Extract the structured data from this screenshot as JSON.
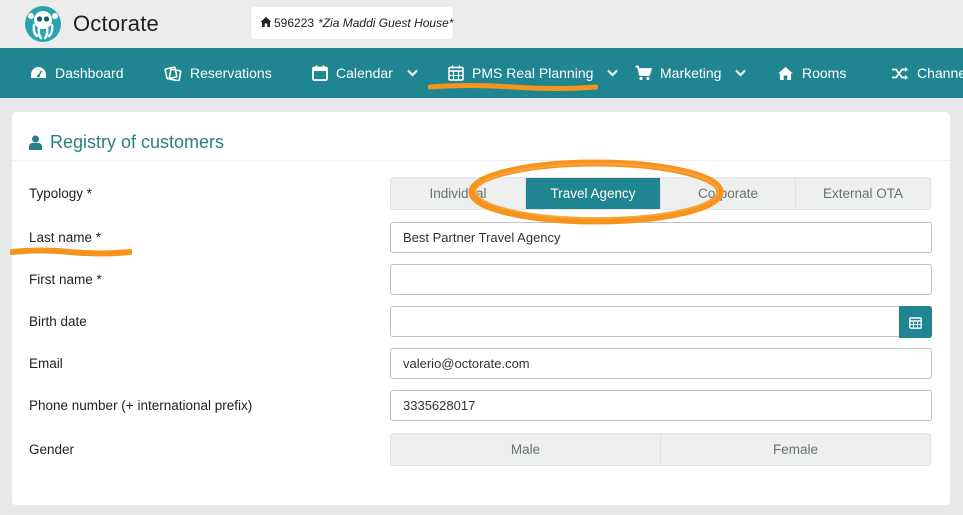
{
  "app": {
    "brand": "Octorate"
  },
  "property": {
    "id": "596223",
    "name": "*Zia Maddi Guest House*"
  },
  "nav": {
    "items": [
      {
        "label": "Dashboard",
        "icon": "dashboard-icon"
      },
      {
        "label": "Reservations",
        "icon": "reservations-icon"
      },
      {
        "label": "Calendar",
        "icon": "calendar-icon",
        "dropdown": true
      },
      {
        "label": "PMS Real Planning",
        "icon": "calendar-grid-icon",
        "dropdown": true,
        "highlighted": true
      },
      {
        "label": "Marketing",
        "icon": "cart-icon",
        "dropdown": true
      },
      {
        "label": "Rooms",
        "icon": "home-icon"
      },
      {
        "label": "Channel",
        "icon": "shuffle-icon"
      }
    ]
  },
  "form": {
    "title": "Registry of customers",
    "typology": {
      "label": "Typology *",
      "options": [
        "Individual",
        "Travel Agency",
        "Corporate",
        "External OTA"
      ],
      "selected": "Travel Agency"
    },
    "last_name": {
      "label": "Last name *",
      "value": "Best Partner Travel Agency"
    },
    "first_name": {
      "label": "First name *",
      "value": ""
    },
    "birth_date": {
      "label": "Birth date",
      "value": ""
    },
    "email": {
      "label": "Email",
      "value": "valerio@octorate.com"
    },
    "phone": {
      "label": "Phone number (+ international prefix)",
      "value": "3335628017"
    },
    "gender": {
      "label": "Gender",
      "options": [
        "Male",
        "Female"
      ],
      "selected": ""
    }
  },
  "colors": {
    "accent": "#1f8590",
    "highlight": "#f7941d",
    "title": "#2a7f89"
  }
}
